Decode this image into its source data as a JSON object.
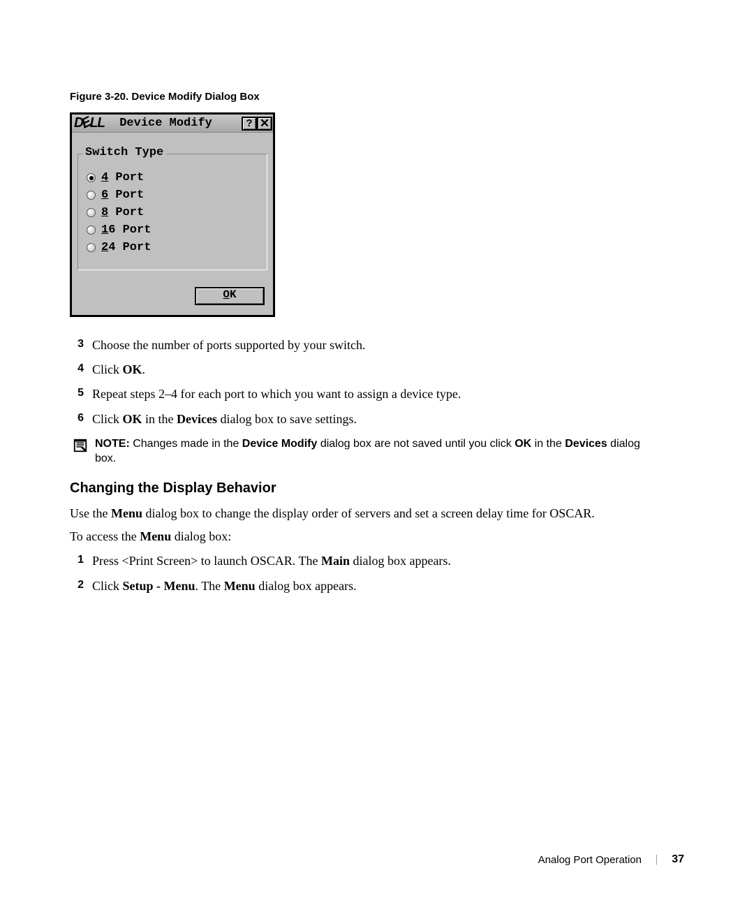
{
  "figure": {
    "caption": "Figure 3-20.    Device Modify Dialog Box"
  },
  "dialog": {
    "logo": "DELL",
    "title": "Device Modify",
    "help": "?",
    "close": "X",
    "fieldset_legend": "Switch Type",
    "options": [
      {
        "mnemonic": "4",
        "rest": " Port",
        "selected": true
      },
      {
        "mnemonic": "6",
        "rest": " Port",
        "selected": false
      },
      {
        "mnemonic": "8",
        "rest": " Port",
        "selected": false
      },
      {
        "mnemonic": "1",
        "rest": "6 Port",
        "selected": false
      },
      {
        "mnemonic": "2",
        "rest": "4 Port",
        "selected": false
      }
    ],
    "ok_mnemonic": "O",
    "ok_rest": "K"
  },
  "steps_a": [
    {
      "num": "3",
      "text": "Choose the number of ports supported by your switch."
    },
    {
      "num": "4",
      "prefix": "Click ",
      "bold1": "OK",
      "suffix": "."
    },
    {
      "num": "5",
      "text": "Repeat steps 2–4 for each port to which you want to assign a device type."
    },
    {
      "num": "6",
      "prefix": "Click ",
      "bold1": "OK",
      "mid": " in the ",
      "bold2": "Devices",
      "suffix": " dialog box to save settings."
    }
  ],
  "note": {
    "label": "NOTE:",
    "prefix": " Changes made in the ",
    "bold1": "Device Modify",
    "mid1": " dialog box are not saved until you click ",
    "bold2": "OK",
    "mid2": " in the ",
    "bold3": "Devices",
    "suffix": " dialog box."
  },
  "section": {
    "heading": "Changing the Display Behavior",
    "para1_prefix": "Use the ",
    "para1_bold": "Menu",
    "para1_suffix": " dialog box to change the display order of servers and set a screen delay time for OSCAR.",
    "para2_prefix": "To access the ",
    "para2_bold": "Menu",
    "para2_suffix": " dialog box:"
  },
  "steps_b": [
    {
      "num": "1",
      "prefix": "Press <Print Screen> to launch OSCAR. The ",
      "bold1": "Main",
      "suffix": " dialog box appears."
    },
    {
      "num": "2",
      "prefix": "Click ",
      "bold1": "Setup - Menu",
      "mid": ". The ",
      "bold2": "Menu",
      "suffix": " dialog box appears."
    }
  ],
  "footer": {
    "section": "Analog Port Operation",
    "divider": "|",
    "page": "37"
  }
}
